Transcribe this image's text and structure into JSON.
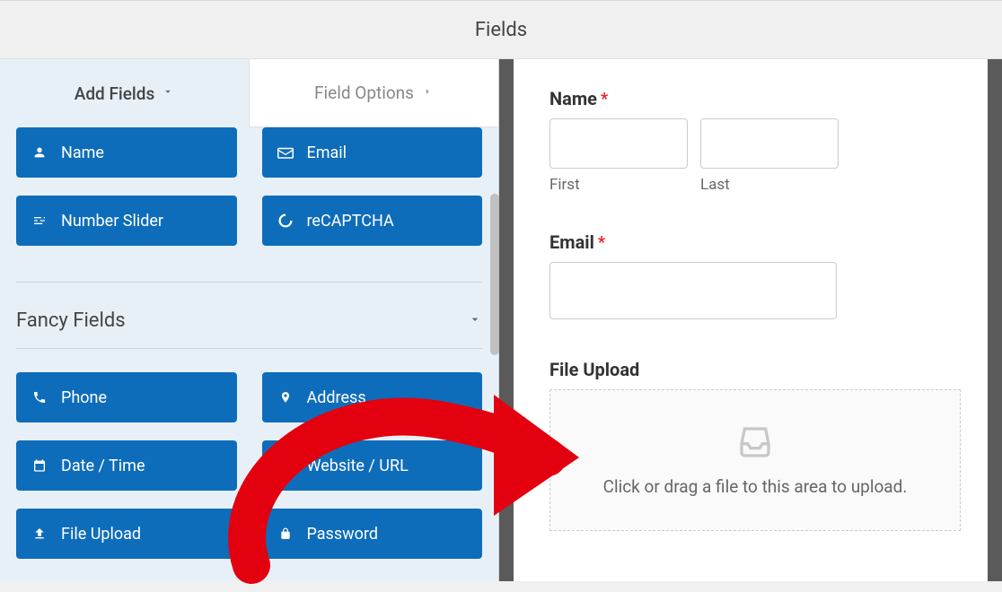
{
  "header": {
    "title": "Fields"
  },
  "tabs": {
    "add_fields": "Add Fields",
    "field_options": "Field Options"
  },
  "standard_fields": [
    {
      "icon": "user",
      "label": "Name"
    },
    {
      "icon": "envelope",
      "label": "Email"
    },
    {
      "icon": "sliders",
      "label": "Number Slider"
    },
    {
      "icon": "recaptcha",
      "label": "reCAPTCHA"
    }
  ],
  "fancy_section": {
    "title": "Fancy Fields"
  },
  "fancy_fields": [
    {
      "icon": "phone",
      "label": "Phone"
    },
    {
      "icon": "pin",
      "label": "Address"
    },
    {
      "icon": "calendar",
      "label": "Date / Time"
    },
    {
      "icon": "link",
      "label": "Website / URL"
    },
    {
      "icon": "upload",
      "label": "File Upload"
    },
    {
      "icon": "lock",
      "label": "Password"
    }
  ],
  "preview": {
    "name_label": "Name",
    "first_label": "First",
    "last_label": "Last",
    "email_label": "Email",
    "fileupload_label": "File Upload",
    "upload_hint": "Click or drag a file to this area to upload."
  }
}
